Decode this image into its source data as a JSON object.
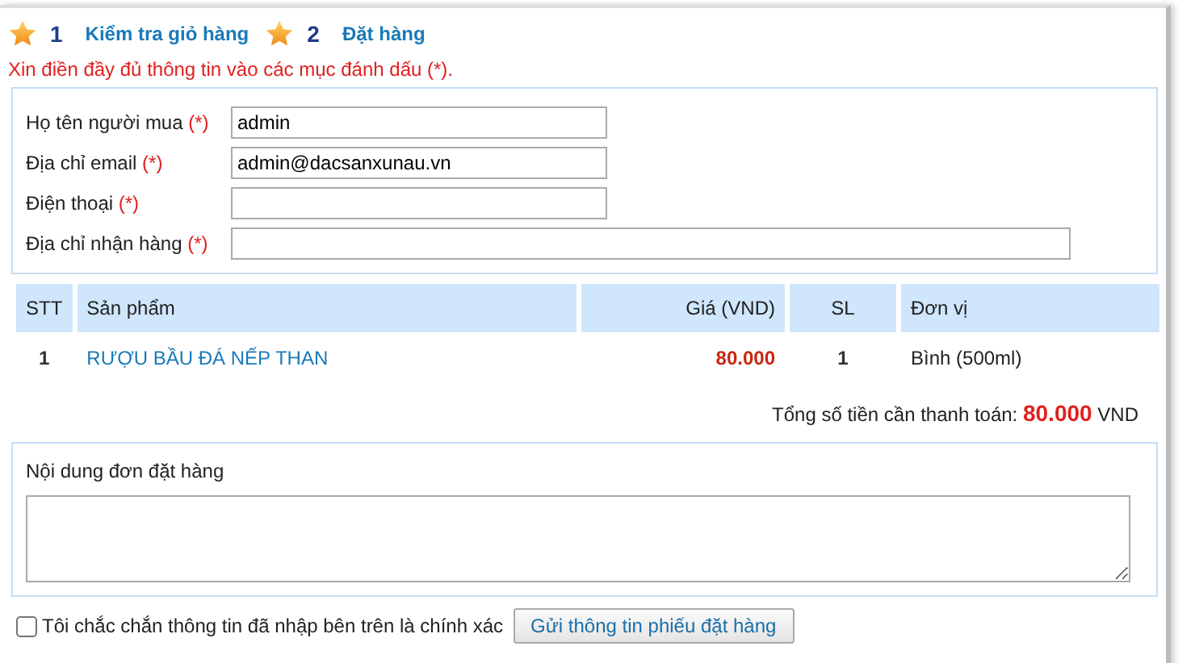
{
  "steps": [
    {
      "number": "1",
      "label": "Kiểm tra giỏ hàng"
    },
    {
      "number": "2",
      "label": "Đặt hàng"
    }
  ],
  "notice": "Xin điền đầy đủ thông tin vào các mục đánh dấu (*).",
  "fields": [
    {
      "label": "Họ tên người mua",
      "required_mark": "(*)",
      "value": "admin",
      "kind": "short"
    },
    {
      "label": "Địa chỉ email",
      "required_mark": "(*)",
      "value": "admin@dacsanxunau.vn",
      "kind": "short"
    },
    {
      "label": "Điện thoại",
      "required_mark": "(*)",
      "kind": "short"
    },
    {
      "label": "Địa chỉ nhận hàng",
      "required_mark": "(*)",
      "kind": "long"
    }
  ],
  "table": {
    "columns": [
      "STT",
      "Sản phẩm",
      "Giá (VND)",
      "SL",
      "Đơn vị"
    ],
    "rows": [
      {
        "stt": "1",
        "product": "RƯỢU BẦU ĐÁ NẾP THAN",
        "price": "80.000",
        "qty": "1",
        "unit": "Bình (500ml)"
      }
    ]
  },
  "total": {
    "label": "Tổng số tiền cần thanh toán:",
    "amount": "80.000",
    "currency": "VND"
  },
  "notes": {
    "label": "Nội dung đơn đặt hàng"
  },
  "confirm": {
    "label": "Tôi chắc chắn thông tin đã nhập bên trên là chính xác",
    "checked": false
  },
  "submit": "Gửi thông tin phiếu đặt hàng"
}
